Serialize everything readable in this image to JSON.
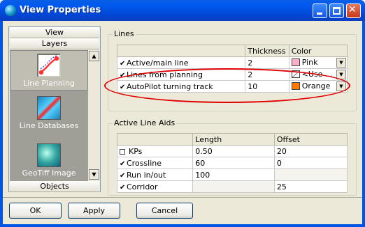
{
  "window": {
    "title": "View Properties"
  },
  "sidebar": {
    "view_tab": "View",
    "layers_tab": "Layers",
    "objects_tab": "Objects",
    "items": [
      {
        "label": "Line Planning"
      },
      {
        "label": "Line Databases"
      },
      {
        "label": "GeoTiff Image"
      }
    ]
  },
  "lines": {
    "title": "Lines",
    "columns": [
      "",
      "Thickness",
      "Color"
    ],
    "rows": [
      {
        "name": "Active/main line",
        "thickness": "2",
        "color": "Pink",
        "swatch": "#ffb0c8",
        "checked": true
      },
      {
        "name": "Lines from planning",
        "thickness": "2",
        "color": "<Use ...",
        "swatch": "none",
        "checked": true
      },
      {
        "name": "AutoPilot turning track",
        "thickness": "10",
        "color": "Orange",
        "swatch": "#ff7800",
        "checked": true
      }
    ]
  },
  "aids": {
    "title": "Active Line Aids",
    "columns": [
      "",
      "Length",
      "Offset"
    ],
    "rows": [
      {
        "name": "KPs",
        "length": "0.50",
        "offset": "20",
        "checked": false
      },
      {
        "name": "Crossline",
        "length": "60",
        "offset": "0",
        "checked": true
      },
      {
        "name": "Run in/out",
        "length": "100",
        "offset": "",
        "checked": true
      },
      {
        "name": "Corridor",
        "length": "",
        "offset": "25",
        "checked": true
      }
    ]
  },
  "buttons": {
    "ok": "OK",
    "apply": "Apply",
    "cancel": "Cancel"
  },
  "icons": {
    "check": "✔",
    "up": "▲",
    "down": "▼"
  }
}
